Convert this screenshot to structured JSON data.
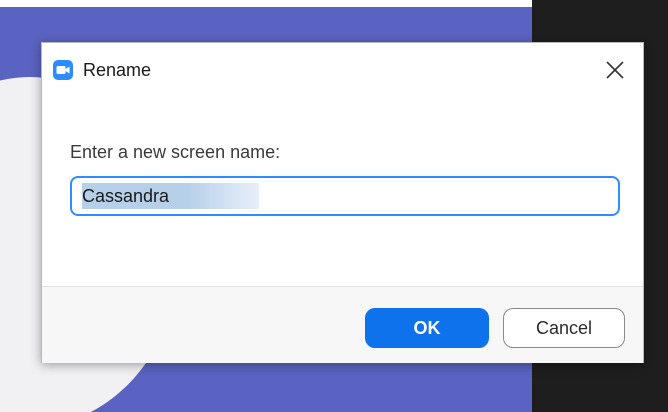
{
  "dialog": {
    "title": "Rename",
    "app_icon": "zoom-camera-icon",
    "close_icon": "close-icon",
    "prompt": "Enter a new screen name:",
    "name_value": "Cassandra",
    "ok_label": "OK",
    "cancel_label": "Cancel"
  },
  "colors": {
    "accent": "#0e72ed",
    "input_border": "#2d8cff",
    "background_purple": "#5a63c1",
    "background_dark": "#1e1e1e"
  }
}
